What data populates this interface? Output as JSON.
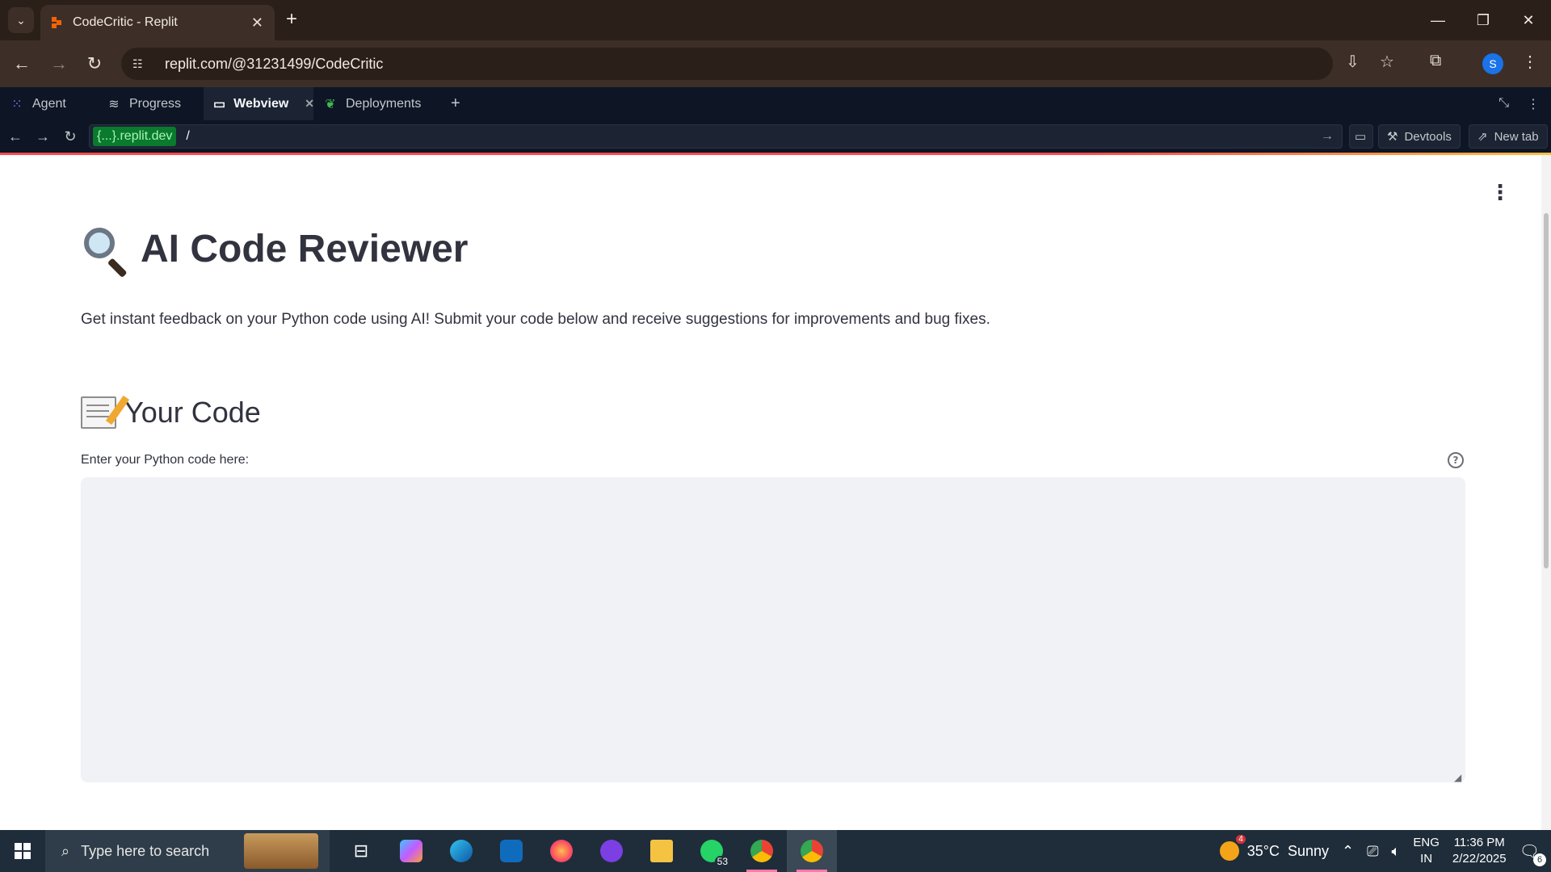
{
  "browser": {
    "tab_title": "CodeCritic - Replit",
    "address": "replit.com/@31231499/CodeCritic",
    "profile_initial": "S"
  },
  "replit": {
    "tabs": [
      {
        "label": "Agent",
        "icon": "agent-grid-icon",
        "active": false
      },
      {
        "label": "Progress",
        "icon": "progress-icon",
        "active": false
      },
      {
        "label": "Webview",
        "icon": "monitor-icon",
        "active": true
      },
      {
        "label": "Deployments",
        "icon": "deploy-icon",
        "active": false
      }
    ],
    "webview": {
      "host": "{...}.replit.dev",
      "path": "/",
      "devtools_label": "Devtools",
      "new_tab_label": "New tab"
    }
  },
  "app": {
    "title": "AI Code Reviewer",
    "title_icon": "magnifying-glass-icon",
    "intro": "Get instant feedback on your Python code using AI! Submit your code below and receive suggestions for improvements and bug fixes.",
    "section_title": "Your Code",
    "section_icon": "memo-icon",
    "code_label": "Enter your Python code here:",
    "code_value": ""
  },
  "taskbar": {
    "search_placeholder": "Type here to search",
    "whatsapp_badge": "53",
    "weather_badge": "4",
    "weather": "35°C  Sunny",
    "lang_top": "ENG",
    "lang_bottom": "IN",
    "time": "11:36 PM",
    "date": "2/22/2025",
    "notifications": "6"
  },
  "colors": {
    "replit_bg": "#0e1525",
    "accent_red": "#ff4b4b",
    "input_bg": "#f0f2f6",
    "text": "#31333f"
  }
}
